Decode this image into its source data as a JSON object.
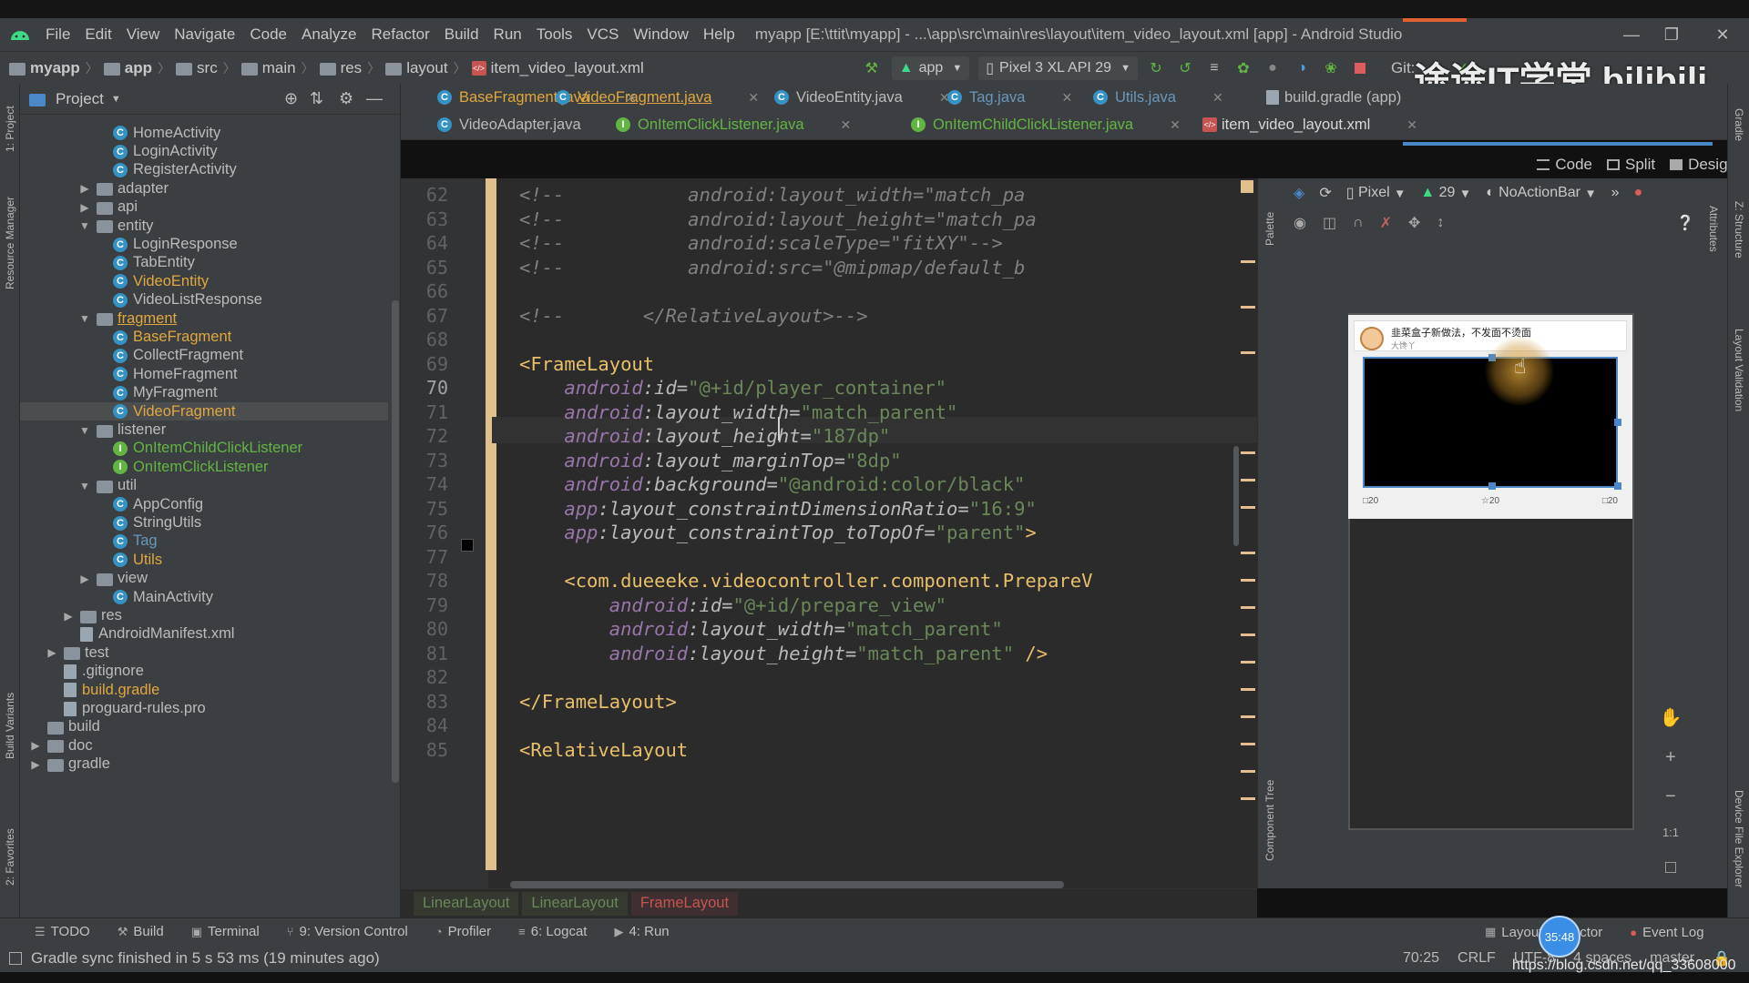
{
  "window": {
    "title": "myapp [E:\\ttit\\myapp] - ...\\app\\src\\main\\res\\layout\\item_video_layout.xml [app] - Android Studio"
  },
  "menu": [
    "File",
    "Edit",
    "View",
    "Navigate",
    "Code",
    "Analyze",
    "Refactor",
    "Build",
    "Run",
    "Tools",
    "VCS",
    "Window",
    "Help"
  ],
  "breadcrumbs": [
    "myapp",
    "app",
    "src",
    "main",
    "res",
    "layout",
    "item_video_layout.xml"
  ],
  "toolbar": {
    "run_config": "app",
    "device": "Pixel 3 XL API 29",
    "git_label": "Git:"
  },
  "project_panel": {
    "title": "Project",
    "tree": [
      {
        "label": "HomeActivity",
        "kind": "class",
        "depth": 3,
        "status": "default"
      },
      {
        "label": "LoginActivity",
        "kind": "class",
        "depth": 3,
        "status": "default"
      },
      {
        "label": "RegisterActivity",
        "kind": "class",
        "depth": 3,
        "status": "default"
      },
      {
        "label": "adapter",
        "kind": "folder",
        "depth": 2,
        "state": "collapsed",
        "status": "default"
      },
      {
        "label": "api",
        "kind": "folder",
        "depth": 2,
        "state": "collapsed",
        "status": "default"
      },
      {
        "label": "entity",
        "kind": "folder",
        "depth": 2,
        "state": "expanded",
        "status": "default"
      },
      {
        "label": "LoginResponse",
        "kind": "class",
        "depth": 3,
        "status": "default"
      },
      {
        "label": "TabEntity",
        "kind": "class",
        "depth": 3,
        "status": "default"
      },
      {
        "label": "VideoEntity",
        "kind": "class",
        "depth": 3,
        "status": "modified"
      },
      {
        "label": "VideoListResponse",
        "kind": "class",
        "depth": 3,
        "status": "default"
      },
      {
        "label": "fragment",
        "kind": "folder",
        "depth": 2,
        "state": "expanded",
        "status": "modified"
      },
      {
        "label": "BaseFragment",
        "kind": "class",
        "depth": 3,
        "status": "modified"
      },
      {
        "label": "CollectFragment",
        "kind": "class",
        "depth": 3,
        "status": "default"
      },
      {
        "label": "HomeFragment",
        "kind": "class",
        "depth": 3,
        "status": "default"
      },
      {
        "label": "MyFragment",
        "kind": "class",
        "depth": 3,
        "status": "default"
      },
      {
        "label": "VideoFragment",
        "kind": "class",
        "depth": 3,
        "status": "modified",
        "selected": true
      },
      {
        "label": "listener",
        "kind": "folder",
        "depth": 2,
        "state": "expanded",
        "status": "default"
      },
      {
        "label": "OnItemChildClickListener",
        "kind": "interface",
        "depth": 3,
        "status": "new"
      },
      {
        "label": "OnItemClickListener",
        "kind": "interface",
        "depth": 3,
        "status": "new"
      },
      {
        "label": "util",
        "kind": "folder",
        "depth": 2,
        "state": "expanded",
        "status": "default"
      },
      {
        "label": "AppConfig",
        "kind": "class",
        "depth": 3,
        "status": "default"
      },
      {
        "label": "StringUtils",
        "kind": "class",
        "depth": 3,
        "status": "default"
      },
      {
        "label": "Tag",
        "kind": "class",
        "depth": 3,
        "status": "tag"
      },
      {
        "label": "Utils",
        "kind": "class",
        "depth": 3,
        "status": "modified"
      },
      {
        "label": "view",
        "kind": "folder",
        "depth": 2,
        "state": "collapsed",
        "status": "default"
      },
      {
        "label": "MainActivity",
        "kind": "class",
        "depth": 3,
        "status": "default"
      },
      {
        "label": "res",
        "kind": "folder",
        "depth": 1,
        "state": "collapsed",
        "status": "default"
      },
      {
        "label": "AndroidManifest.xml",
        "kind": "file",
        "depth": 1,
        "status": "default"
      },
      {
        "label": "test",
        "kind": "folder",
        "depth": 0,
        "state": "collapsed",
        "status": "default"
      },
      {
        "label": ".gitignore",
        "kind": "file",
        "depth": 0,
        "status": "default"
      },
      {
        "label": "build.gradle",
        "kind": "file",
        "depth": 0,
        "status": "modified"
      },
      {
        "label": "proguard-rules.pro",
        "kind": "file",
        "depth": 0,
        "status": "default"
      },
      {
        "label": "build",
        "kind": "folder",
        "depth": -1,
        "state": "none",
        "status": "default"
      },
      {
        "label": "doc",
        "kind": "folder",
        "depth": -1,
        "state": "collapsed",
        "status": "default"
      },
      {
        "label": "gradle",
        "kind": "folder",
        "depth": -1,
        "state": "collapsed",
        "status": "default"
      }
    ]
  },
  "editor_tabs": {
    "row1": [
      {
        "label": "BaseFragment.java",
        "kind": "class",
        "status": "modified"
      },
      {
        "label": "VideoFragment.java",
        "kind": "class",
        "status": "modified",
        "underline": true
      },
      {
        "label": "VideoEntity.java",
        "kind": "class",
        "status": "default"
      },
      {
        "label": "Tag.java",
        "kind": "class",
        "status": "tag"
      },
      {
        "label": "Utils.java",
        "kind": "class",
        "status": "tag"
      },
      {
        "label": "build.gradle (app)",
        "kind": "gradle",
        "status": "default"
      }
    ],
    "row2": [
      {
        "label": "VideoAdapter.java",
        "kind": "class",
        "status": "default"
      },
      {
        "label": "OnItemClickListener.java",
        "kind": "interface",
        "status": "new"
      },
      {
        "label": "OnItemChildClickListener.java",
        "kind": "interface",
        "status": "new"
      },
      {
        "label": "item_video_layout.xml",
        "kind": "xml",
        "status": "default",
        "active": true
      }
    ]
  },
  "view_modes": [
    "Code",
    "Split",
    "Design"
  ],
  "code": {
    "first_line": 62,
    "current_line": 70,
    "lines": [
      [
        {
          "t": "<!--",
          "c": "comment"
        },
        {
          "t": "           android:layout_width=\"match_pa",
          "c": "comment"
        }
      ],
      [
        {
          "t": "<!--",
          "c": "comment"
        },
        {
          "t": "           android:layout_height=\"match_pa",
          "c": "comment"
        }
      ],
      [
        {
          "t": "<!--",
          "c": "comment"
        },
        {
          "t": "           android:scaleType=\"fitXY\"-->",
          "c": "comment"
        }
      ],
      [
        {
          "t": "<!--",
          "c": "comment"
        },
        {
          "t": "           android:src=\"@mipmap/default_b",
          "c": "comment"
        }
      ],
      [],
      [
        {
          "t": "<!--",
          "c": "comment"
        },
        {
          "t": "       </RelativeLayout>-->",
          "c": "comment"
        }
      ],
      [],
      [
        {
          "t": "<",
          "c": "bracket"
        },
        {
          "t": "FrameLayout",
          "c": "tag"
        }
      ],
      [
        {
          "t": "    android",
          "c": "attr"
        },
        {
          "t": ":id=",
          "c": "attr"
        },
        {
          "t": "\"@+id/player_container\"",
          "c": "value"
        }
      ],
      [
        {
          "t": "    android",
          "c": "attr"
        },
        {
          "t": ":layout_width=",
          "c": "attr"
        },
        {
          "t": "\"match_parent\"",
          "c": "value"
        }
      ],
      [
        {
          "t": "    android",
          "c": "attr"
        },
        {
          "t": ":layout_height=",
          "c": "attr"
        },
        {
          "t": "\"187dp\"",
          "c": "value"
        }
      ],
      [
        {
          "t": "    android",
          "c": "attr"
        },
        {
          "t": ":layout_marginTop=",
          "c": "attr"
        },
        {
          "t": "\"8dp\"",
          "c": "value"
        }
      ],
      [
        {
          "t": "    android",
          "c": "attr"
        },
        {
          "t": ":background=",
          "c": "attr"
        },
        {
          "t": "\"@android:color/black\"",
          "c": "value"
        }
      ],
      [
        {
          "t": "    app",
          "c": "attr"
        },
        {
          "t": ":layout_constraintDimensionRatio=",
          "c": "attr"
        },
        {
          "t": "\"16:9\"",
          "c": "value"
        }
      ],
      [
        {
          "t": "    app",
          "c": "attr"
        },
        {
          "t": ":layout_constraintTop_toTopOf=",
          "c": "attr"
        },
        {
          "t": "\"parent\"",
          "c": "value"
        },
        {
          "t": ">",
          "c": "bracket"
        }
      ],
      [],
      [
        {
          "t": "    <",
          "c": "bracket"
        },
        {
          "t": "com.dueeeke.videocontroller.component.PrepareV",
          "c": "tag"
        }
      ],
      [
        {
          "t": "        android",
          "c": "attr"
        },
        {
          "t": ":id=",
          "c": "attr"
        },
        {
          "t": "\"@+id/prepare_view\"",
          "c": "value"
        }
      ],
      [
        {
          "t": "        android",
          "c": "attr"
        },
        {
          "t": ":layout_width=",
          "c": "attr"
        },
        {
          "t": "\"match_parent\"",
          "c": "value"
        }
      ],
      [
        {
          "t": "        android",
          "c": "attr"
        },
        {
          "t": ":layout_height=",
          "c": "attr"
        },
        {
          "t": "\"match_parent\"",
          "c": "value"
        },
        {
          "t": " />",
          "c": "bracket"
        }
      ],
      [],
      [
        {
          "t": "</",
          "c": "bracket"
        },
        {
          "t": "FrameLayout",
          "c": "tag"
        },
        {
          "t": ">",
          "c": "bracket"
        }
      ],
      [],
      [
        {
          "t": "<",
          "c": "bracket"
        },
        {
          "t": "RelativeLayout",
          "c": "tag"
        }
      ]
    ]
  },
  "code_breadcrumbs": [
    "LinearLayout",
    "LinearLayout",
    "FrameLayout"
  ],
  "design": {
    "device": "Pixel",
    "api": "29",
    "theme": "NoActionBar",
    "preview_title": "韭菜盒子新做法，不发面不烫面",
    "preview_sub": "大馋丫",
    "counts": [
      "20",
      "20",
      "20"
    ],
    "zoom_label": "1:1"
  },
  "left_stripe": [
    "1: Project",
    "Resource Manager",
    "Build Variants",
    "2: Favorites"
  ],
  "right_stripe": [
    "Gradle",
    "Z: Structure",
    "Layout Validation",
    "Device File Explorer"
  ],
  "design_stripe": [
    "Palette",
    "Component Tree"
  ],
  "design_right_label": "Attributes",
  "bottom_tools": [
    {
      "icon": "todo-icon",
      "label": "TODO"
    },
    {
      "icon": "build-icon",
      "label": "Build"
    },
    {
      "icon": "terminal-icon",
      "label": "Terminal"
    },
    {
      "icon": "vcs-icon",
      "label": "9: Version Control"
    },
    {
      "icon": "profiler-icon",
      "label": "Profiler"
    },
    {
      "icon": "logcat-icon",
      "label": "6: Logcat"
    },
    {
      "icon": "run-icon",
      "label": "4: Run"
    }
  ],
  "bottom_right_tools": [
    "Layout Inspector",
    "Event Log"
  ],
  "status": {
    "message": "Gradle sync finished in 5 s 53 ms (19 minutes ago)",
    "position": "70:25",
    "line_sep": "CRLF",
    "encoding": "UTF-8",
    "indent": "4 spaces",
    "branch": "master"
  },
  "overlay": {
    "watermark": "途途IT学堂 bilibili",
    "timer": "35:48",
    "csdn": "https://blog.csdn.net/qq_33608000"
  }
}
